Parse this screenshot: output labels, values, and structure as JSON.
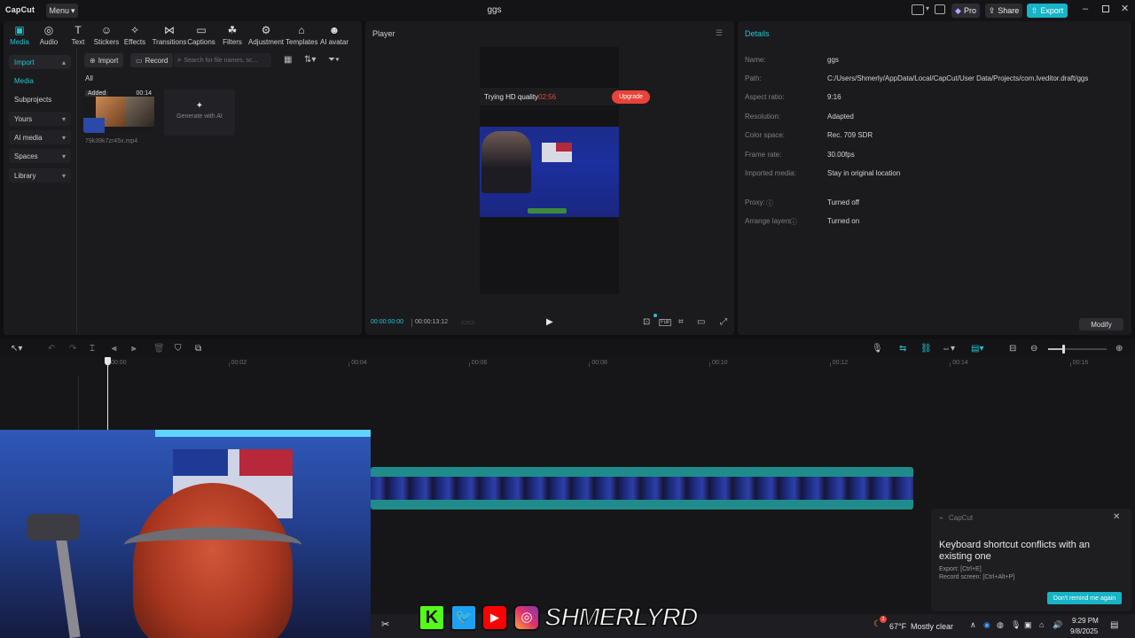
{
  "app": {
    "logo": "CapCut",
    "menu_label": "Menu",
    "window_title": "ggs"
  },
  "topbar": {
    "pro_label": "Pro",
    "share_label": "Share",
    "export_label": "Export"
  },
  "toolbar": [
    {
      "label": "Media",
      "icon": "media-icon"
    },
    {
      "label": "Audio",
      "icon": "audio-icon"
    },
    {
      "label": "Text",
      "icon": "text-icon"
    },
    {
      "label": "Stickers",
      "icon": "stickers-icon"
    },
    {
      "label": "Effects",
      "icon": "effects-icon"
    },
    {
      "label": "Transitions",
      "icon": "transitions-icon"
    },
    {
      "label": "Captions",
      "icon": "captions-icon"
    },
    {
      "label": "Filters",
      "icon": "filters-icon"
    },
    {
      "label": "Adjustment",
      "icon": "adjustment-icon"
    },
    {
      "label": "Templates",
      "icon": "templates-icon"
    },
    {
      "label": "AI avatar",
      "icon": "ai-avatar-icon"
    }
  ],
  "sidebar": [
    {
      "label": "Import"
    },
    {
      "label": "Media"
    },
    {
      "label": "Subprojects"
    },
    {
      "label": "Yours"
    },
    {
      "label": "AI media"
    },
    {
      "label": "Spaces"
    },
    {
      "label": "Library"
    }
  ],
  "media": {
    "import_label": "Import",
    "record_label": "Record",
    "search_placeholder": "Search for file names, sc...",
    "filter_all": "All",
    "clip_badge": "Added",
    "clip_duration": "00:14",
    "clip_name": "79k39k7zr45x.mp4",
    "generate_label": "Generate with AI"
  },
  "player": {
    "title": "Player",
    "hd_text": "Trying HD quality",
    "hd_timer": "02:56",
    "upgrade_label": "Upgrade",
    "current_time": "00:00:00:00",
    "total_time": "00:00:13:12",
    "full_label": "Full"
  },
  "details": {
    "title": "Details",
    "rows": [
      {
        "label": "Name:",
        "value": "ggs"
      },
      {
        "label": "Path:",
        "value": "C:/Users/Shmerly/AppData/Local/CapCut/User Data/Projects/com.lveditor.draft/ggs"
      },
      {
        "label": "Aspect ratio:",
        "value": "9:16"
      },
      {
        "label": "Resolution:",
        "value": "Adapted"
      },
      {
        "label": "Color space:",
        "value": "Rec. 709 SDR"
      },
      {
        "label": "Frame rate:",
        "value": "30.00fps"
      },
      {
        "label": "Imported media:",
        "value": "Stay in original location"
      },
      {
        "label": "Proxy:",
        "value": "Turned off"
      },
      {
        "label": "Arrange layers",
        "value": "Turned on"
      }
    ],
    "modify_label": "Modify"
  },
  "timeline": {
    "ticks": [
      "00:00",
      "00:02",
      "00:04",
      "00:06",
      "00:08",
      "00:10",
      "00:12",
      "00:14",
      "00:16"
    ]
  },
  "notification": {
    "app": "CapCut",
    "title": "Keyboard shortcut conflicts with an existing one",
    "line1": "Export: [Ctrl+E]",
    "line2": "Record screen: [Ctrl+Alt+P]",
    "button": "Don't remind me again"
  },
  "overlay": {
    "channel": "SHMERLYRD"
  },
  "taskbar": {
    "weather_temp": "67°F",
    "weather_text": "Mostly clear",
    "time": "9:29 PM",
    "date": "9/8/2025",
    "weather_badge": "1"
  },
  "colors": {
    "accent": "#23c4d2",
    "upgrade": "#e8433a",
    "export": "#17b3c6",
    "clip": "#1f8c8b"
  }
}
